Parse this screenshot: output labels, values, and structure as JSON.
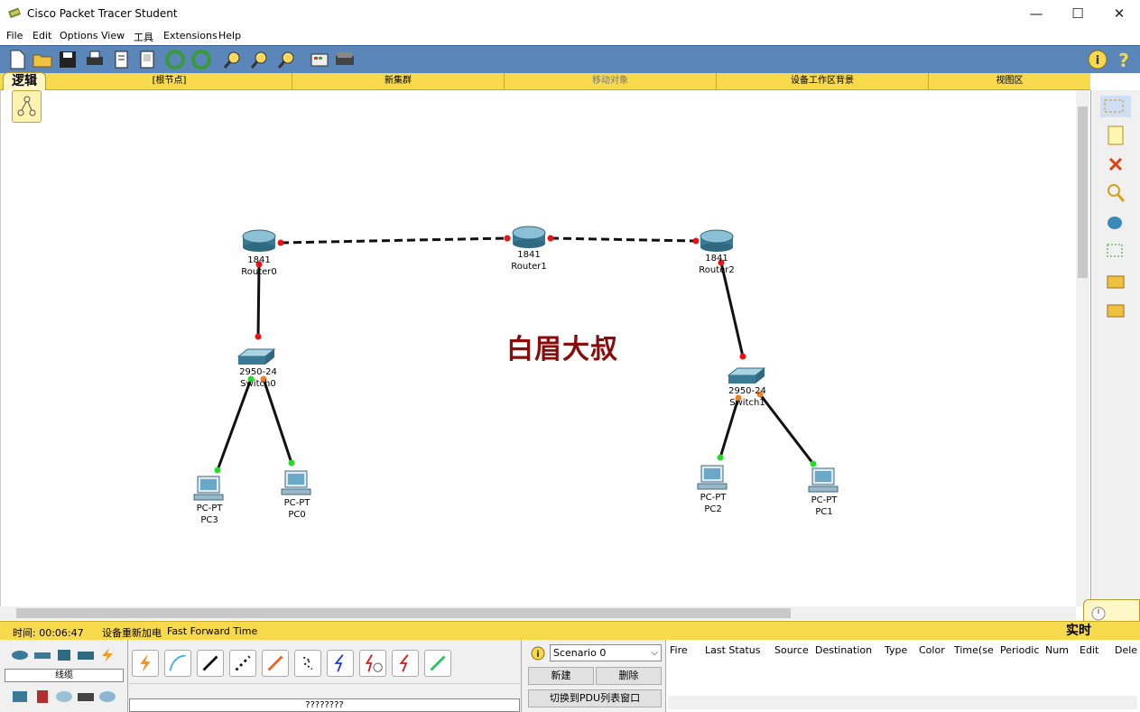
{
  "app": {
    "title": "Cisco Packet Tracer Student",
    "window_controls": {
      "minimize": "—",
      "maximize": "☐",
      "close": "✕"
    }
  },
  "menu": [
    "File",
    "Edit",
    "Options",
    "View",
    "工具",
    "Extensions",
    "Help"
  ],
  "workspace_bar": {
    "logic_tab": "逻辑",
    "root_node": "[根节点]",
    "new_cluster": "新集群",
    "move_object": "移动对象",
    "workspace_background": "设备工作区背景",
    "viewport": "视图区"
  },
  "watermark": "白眉大叔",
  "devices": [
    {
      "model": "1841",
      "name": "Router0"
    },
    {
      "model": "1841",
      "name": "Router1"
    },
    {
      "model": "1841",
      "name": "Router2"
    },
    {
      "model": "2950-24",
      "name": "Switch0"
    },
    {
      "model": "2950-24",
      "name": "Switch1"
    },
    {
      "model": "PC-PT",
      "name": "PC3"
    },
    {
      "model": "PC-PT",
      "name": "PC0"
    },
    {
      "model": "PC-PT",
      "name": "PC2"
    },
    {
      "model": "PC-PT",
      "name": "PC1"
    }
  ],
  "status": {
    "time": "时间: 00:06:47",
    "power_cycle": "设备重新加电",
    "fast_forward": "Fast Forward Time",
    "mode": "实时"
  },
  "device_panel": {
    "category_label": "线缆",
    "device_name": "????????"
  },
  "scenario": {
    "selected": "Scenario 0",
    "new_button": "新建",
    "delete_button": "删除",
    "toggle_pdu_button": "切换到PDU列表窗口"
  },
  "pdu_columns": [
    "Fire",
    "Last Status",
    "Source",
    "Destination",
    "Type",
    "Color",
    "Time(se",
    "Periodic",
    "Num",
    "Edit",
    "Dele"
  ],
  "colors": {
    "toolbar": "#5a86b9",
    "yellow_bar": "#f7d94c",
    "link_up": "#22dd22",
    "link_down": "#ee1111",
    "watermark": "#8b0a0a"
  }
}
